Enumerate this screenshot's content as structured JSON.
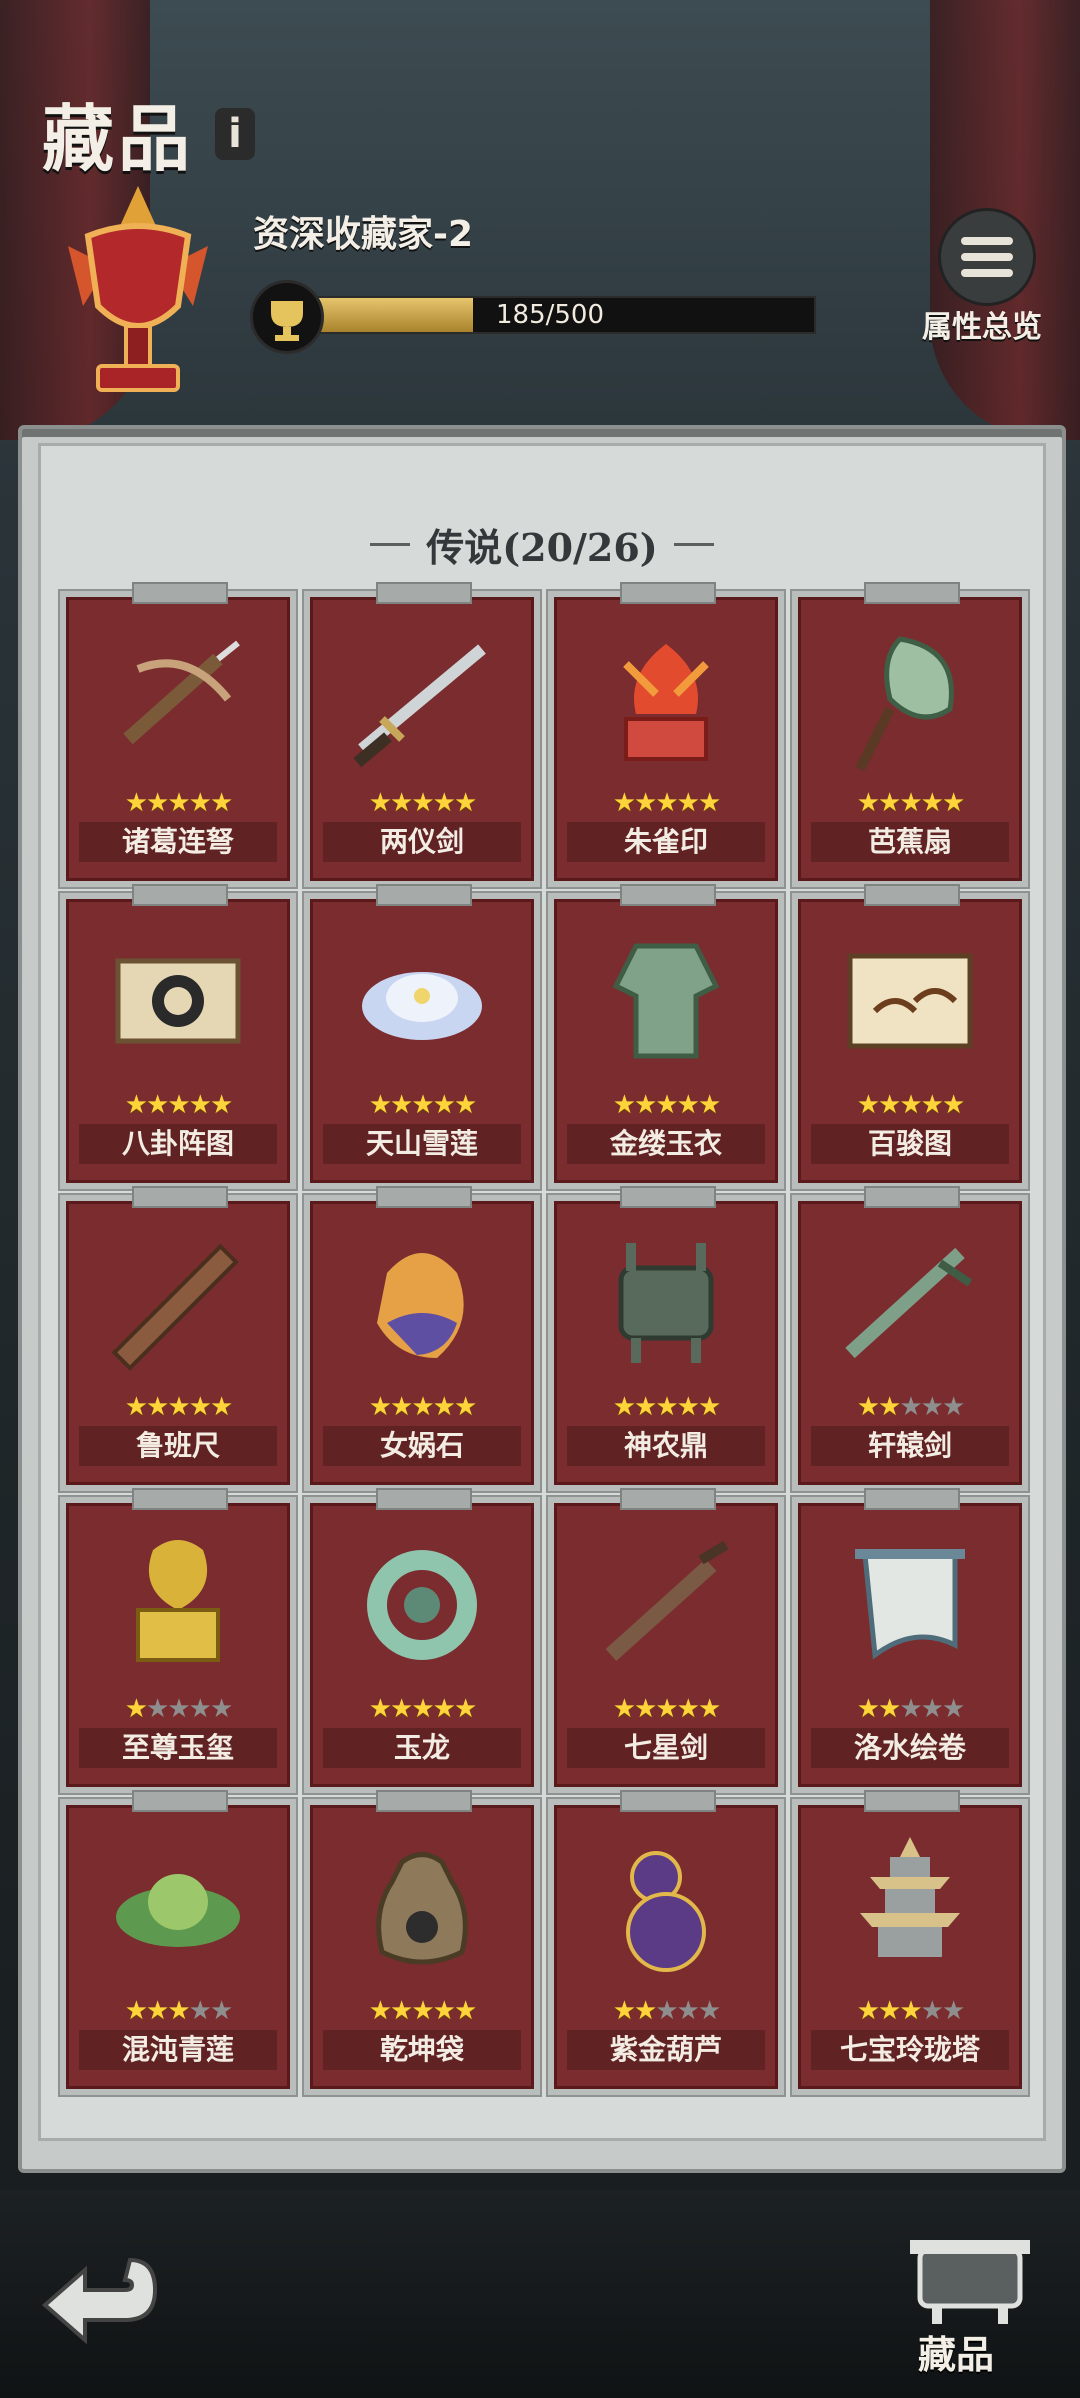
{
  "header": {
    "title": "藏品",
    "rank_name": "资深收藏家-2",
    "exp_text": "185/500",
    "exp_progress": 0.37,
    "attr_label": "属性总览"
  },
  "section": {
    "title": "传说(20/26)"
  },
  "items": [
    {
      "name": "诸葛连弩",
      "stars": 5,
      "icon": "crossbow-icon"
    },
    {
      "name": "两仪剑",
      "stars": 5,
      "icon": "sword-icon"
    },
    {
      "name": "朱雀印",
      "stars": 5,
      "icon": "phoenix-seal-icon"
    },
    {
      "name": "芭蕉扇",
      "stars": 5,
      "icon": "fan-icon"
    },
    {
      "name": "八卦阵图",
      "stars": 5,
      "icon": "bagua-scroll-icon"
    },
    {
      "name": "天山雪莲",
      "stars": 5,
      "icon": "snow-lotus-icon"
    },
    {
      "name": "金缕玉衣",
      "stars": 5,
      "icon": "jade-armor-icon"
    },
    {
      "name": "百骏图",
      "stars": 5,
      "icon": "horse-painting-icon"
    },
    {
      "name": "鲁班尺",
      "stars": 5,
      "icon": "ruler-icon"
    },
    {
      "name": "女娲石",
      "stars": 5,
      "icon": "rainbow-stone-icon"
    },
    {
      "name": "神农鼎",
      "stars": 5,
      "icon": "cauldron-icon"
    },
    {
      "name": "轩辕剑",
      "stars": 2,
      "icon": "jade-sword-icon"
    },
    {
      "name": "至尊玉玺",
      "stars": 1,
      "icon": "imperial-seal-icon"
    },
    {
      "name": "玉龙",
      "stars": 5,
      "icon": "jade-dragon-icon"
    },
    {
      "name": "七星剑",
      "stars": 5,
      "icon": "seven-star-sword-icon"
    },
    {
      "name": "洛水绘卷",
      "stars": 2,
      "icon": "painting-scroll-icon"
    },
    {
      "name": "混沌青莲",
      "stars": 3,
      "icon": "green-lotus-icon"
    },
    {
      "name": "乾坤袋",
      "stars": 5,
      "icon": "pouch-icon"
    },
    {
      "name": "紫金葫芦",
      "stars": 2,
      "icon": "gourd-icon"
    },
    {
      "name": "七宝玲珑塔",
      "stars": 3,
      "icon": "pagoda-icon"
    }
  ],
  "footer": {
    "collect_label": "藏品"
  }
}
